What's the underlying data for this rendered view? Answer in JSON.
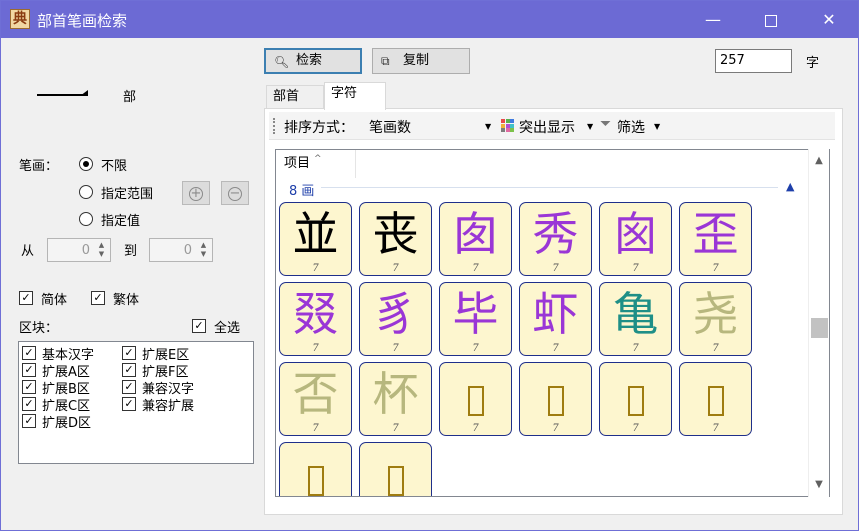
{
  "window": {
    "title": "部首笔画检索",
    "app_icon_glyph": "典",
    "controls": {
      "minimize": "—",
      "maximize": "",
      "close": "✕"
    }
  },
  "radical": {
    "label": "部"
  },
  "strokes": {
    "label": "笔画：",
    "options": [
      {
        "label": "不限",
        "checked": true
      },
      {
        "label": "指定范围",
        "checked": false
      },
      {
        "label": "指定值",
        "checked": false
      }
    ],
    "add_glyph": "+",
    "remove_glyph": "−",
    "from_label": "从",
    "to_label": "到",
    "from_value": "0",
    "to_value": "0"
  },
  "script": {
    "simplified": {
      "label": "简体",
      "checked": true
    },
    "traditional": {
      "label": "繁体",
      "checked": true
    }
  },
  "blocks": {
    "label": "区块：",
    "select_all": {
      "label": "全选",
      "checked": true
    },
    "items": [
      {
        "label": "基本汉字",
        "checked": true
      },
      {
        "label": "扩展A区",
        "checked": true
      },
      {
        "label": "扩展B区",
        "checked": true
      },
      {
        "label": "扩展C区",
        "checked": true
      },
      {
        "label": "扩展D区",
        "checked": true
      },
      {
        "label": "扩展E区",
        "checked": true
      },
      {
        "label": "扩展F区",
        "checked": true
      },
      {
        "label": "兼容汉字",
        "checked": true
      },
      {
        "label": "兼容扩展",
        "checked": true
      }
    ]
  },
  "actions": {
    "search_label": "检索",
    "copy_label": "复制",
    "count_value": "257",
    "count_unit": "字"
  },
  "tabs": [
    {
      "label": "部首",
      "active": false
    },
    {
      "label": "字符",
      "active": true
    }
  ],
  "toolbar": {
    "sort_label": "排序方式：",
    "sort_value": "笔画数",
    "highlight_label": "突出显示",
    "filter_label": "筛选"
  },
  "list": {
    "column_header": "项目",
    "group_label": "8 画",
    "group_collapse": "▲",
    "tiles": [
      {
        "char": "並",
        "count": "7",
        "color": "#000000"
      },
      {
        "char": "丧",
        "count": "7",
        "color": "#000000"
      },
      {
        "char": "囱",
        "count": "7",
        "color": "#9a36d6"
      },
      {
        "char": "秀",
        "count": "7",
        "color": "#9a36d6"
      },
      {
        "char": "囪",
        "count": "7",
        "color": "#9a36d6"
      },
      {
        "char": "歪",
        "count": "7",
        "color": "#9a36d6"
      },
      {
        "char": "叕",
        "count": "7",
        "color": "#9a36d6"
      },
      {
        "char": "豸",
        "count": "7",
        "color": "#9a36d6"
      },
      {
        "char": "毕",
        "count": "7",
        "color": "#9a36d6"
      },
      {
        "char": "虾",
        "count": "7",
        "color": "#9a36d6"
      },
      {
        "char": "亀",
        "count": "7",
        "color": "#1f8f87"
      },
      {
        "char": "尧",
        "count": "7",
        "color": "#b7b77e"
      },
      {
        "char": "否",
        "count": "7",
        "color": "#b7b77e"
      },
      {
        "char": "杯",
        "count": "7",
        "color": "#b7b77e"
      },
      {
        "char": "",
        "count": "7",
        "color": "#9f7c10"
      },
      {
        "char": "",
        "count": "7",
        "color": "#9f7c10"
      },
      {
        "char": "",
        "count": "7",
        "color": "#9f7c10"
      },
      {
        "char": "",
        "count": "7",
        "color": "#9f7c10"
      },
      {
        "char": "",
        "count": "",
        "color": "#9f7c10"
      },
      {
        "char": "",
        "count": "",
        "color": "#9f7c10"
      }
    ]
  },
  "scrollbar": {
    "up": "▲",
    "down": "▼"
  }
}
